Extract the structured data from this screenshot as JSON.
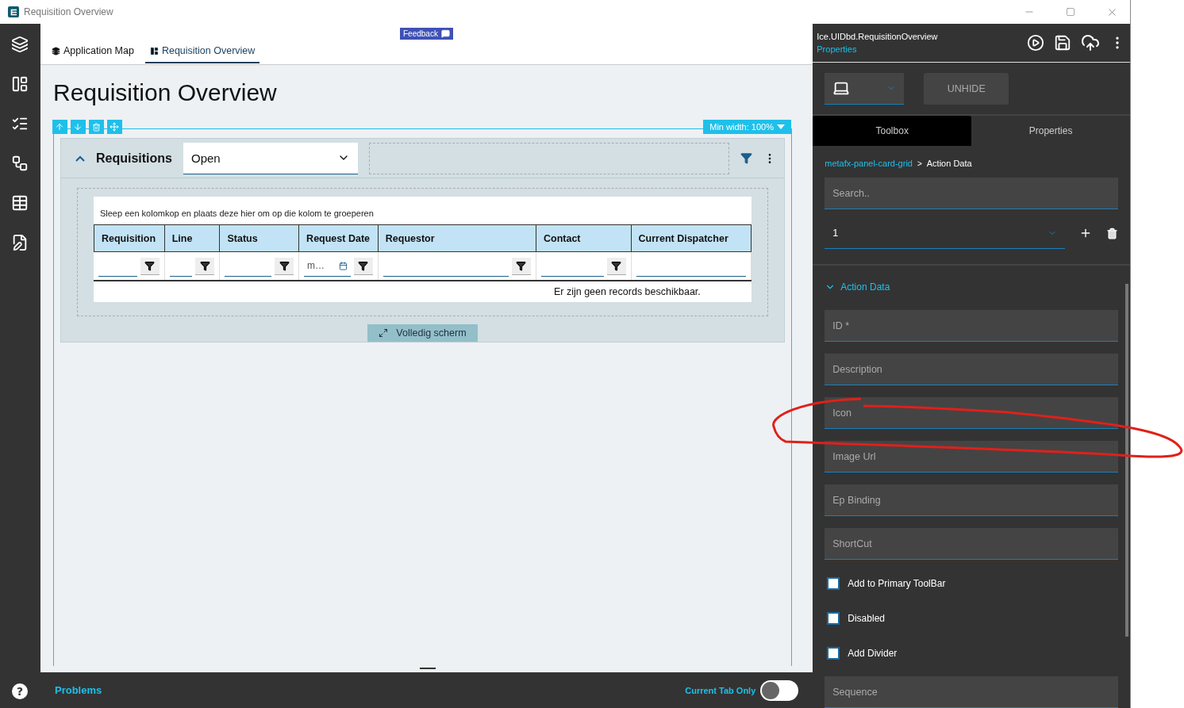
{
  "window": {
    "title": "Requisition Overview"
  },
  "rail": {
    "items": [
      {
        "kind": "layers"
      },
      {
        "kind": "layout"
      },
      {
        "kind": "checklist"
      },
      {
        "kind": "flow"
      },
      {
        "kind": "grid"
      },
      {
        "kind": "edit"
      }
    ],
    "help": "?"
  },
  "feedback": "Feedback",
  "tabs": [
    {
      "label": "Application Map",
      "kind": "map",
      "selected": false
    },
    {
      "label": "Requisition Overview",
      "kind": "page",
      "selected": true
    }
  ],
  "page_title": "Requisition Overview",
  "min_width": "Min width: 100%",
  "card": {
    "title": "Requisitions",
    "expanded": true,
    "filter": {
      "value": "Open"
    },
    "group_hint": "Sleep een kolomkop en plaats deze hier om op die kolom te groeperen",
    "columns": [
      {
        "label": "Requisition"
      },
      {
        "label": "Line"
      },
      {
        "label": "Status"
      },
      {
        "label": "Request Date",
        "filter": "m…",
        "kind": "date"
      },
      {
        "label": "Requestor"
      },
      {
        "label": "Contact"
      },
      {
        "label": "Current Dispatcher",
        "kind": "plain"
      }
    ],
    "empty": "Er zijn geen records beschikbaar.",
    "fullscreen": "Volledig scherm"
  },
  "bottom_bar": {
    "problems": "Problems",
    "current_tab_only": {
      "label": "Current Tab Only",
      "on": false
    }
  },
  "panel": {
    "id": "Ice.UIDbd.RequisitionOverview",
    "subtitle": "Properties",
    "unhide": "UNHIDE",
    "tabs": [
      {
        "label": "Toolbox",
        "selected": true
      },
      {
        "label": "Properties",
        "selected": false
      }
    ],
    "breadcrumb": [
      {
        "label": "metafx-panel-card-grid",
        "kind": "link"
      },
      {
        "label": ">",
        "kind": "sep"
      },
      {
        "label": "Action Data",
        "kind": "current"
      }
    ],
    "search": {
      "placeholder": "Search.."
    },
    "index_select": {
      "value": "1"
    },
    "section": {
      "title": "Action Data",
      "expanded": true
    },
    "fields": [
      {
        "placeholder": "ID *",
        "kind": "text"
      },
      {
        "placeholder": "Description",
        "kind": "text"
      },
      {
        "placeholder": "Icon",
        "kind": "text"
      },
      {
        "placeholder": "Image Url",
        "kind": "text"
      },
      {
        "placeholder": "Ep Binding",
        "kind": "text"
      },
      {
        "placeholder": "ShortCut",
        "kind": "text"
      },
      {
        "label": "Add to Primary ToolBar",
        "kind": "checkbox",
        "checked": false
      },
      {
        "label": "Disabled",
        "kind": "checkbox",
        "checked": false
      },
      {
        "label": "Add Divider",
        "kind": "checkbox",
        "checked": false
      },
      {
        "placeholder": "Sequence",
        "kind": "text"
      }
    ]
  }
}
